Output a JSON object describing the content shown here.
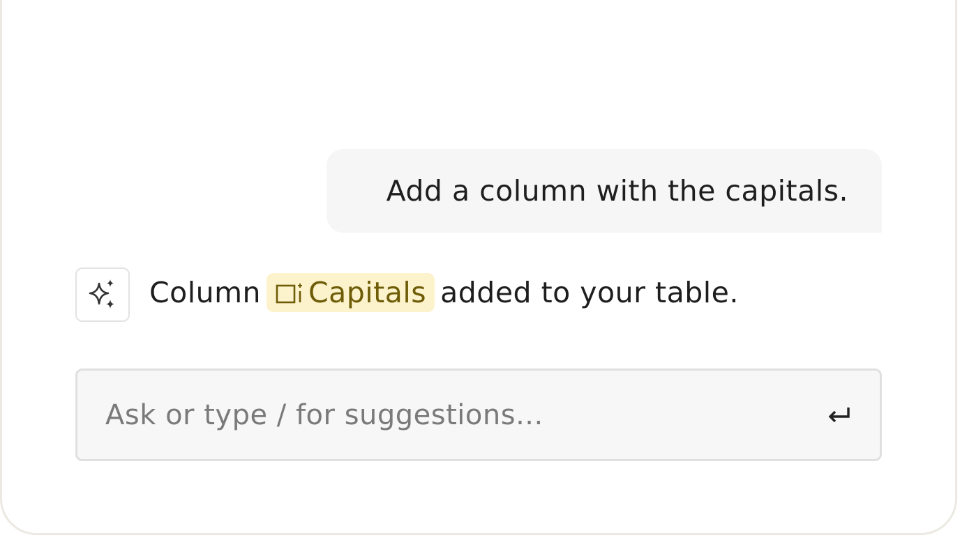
{
  "conversation": {
    "user_message": "Add a column with the capitals.",
    "assistant_message": {
      "prefix": "Column",
      "column_name": "Capitals",
      "suffix": "added to your table."
    }
  },
  "composer": {
    "placeholder": "Ask or type / for suggestions...",
    "value": ""
  },
  "icons": {
    "assistant": "sparkles-icon",
    "column": "add-column-icon",
    "submit": "enter-return-icon"
  },
  "colors": {
    "chip_background": "#fcf3cc",
    "chip_text": "#6e5c07",
    "bubble_background": "#f6f6f6",
    "panel_border": "#ebe9e2"
  }
}
